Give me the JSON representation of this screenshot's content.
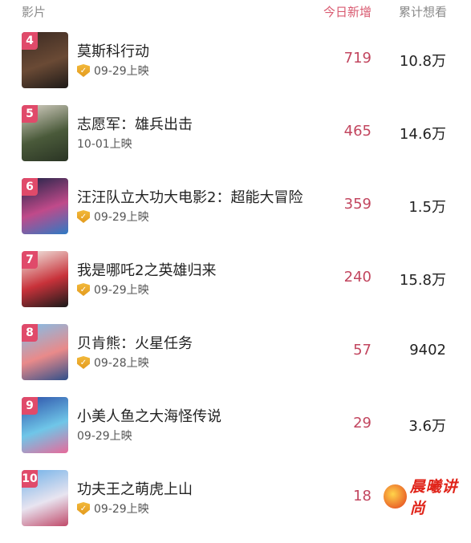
{
  "header": {
    "movie_label": "影片",
    "today_label": "今日新增",
    "total_label": "累计想看"
  },
  "movies": [
    {
      "rank": "4",
      "title": "莫斯科行动",
      "date": "09-29上映",
      "badge": true,
      "today": "719",
      "total": "10.8万",
      "poster_colors": [
        "#3b2a22",
        "#6a4a35",
        "#1e1a18"
      ]
    },
    {
      "rank": "5",
      "title": "志愿军：雄兵出击",
      "date": "10-01上映",
      "badge": false,
      "today": "465",
      "total": "14.6万",
      "poster_colors": [
        "#d8d2c6",
        "#4a5a3a",
        "#2a3424"
      ]
    },
    {
      "rank": "6",
      "title": "汪汪队立大功大电影2：超能大冒险",
      "date": "09-29上映",
      "badge": true,
      "today": "359",
      "total": "1.5万",
      "poster_colors": [
        "#1d2346",
        "#c04a8a",
        "#2e7ac4"
      ]
    },
    {
      "rank": "7",
      "title": "我是哪吒2之英雄归来",
      "date": "09-29上映",
      "badge": true,
      "today": "240",
      "total": "15.8万",
      "poster_colors": [
        "#f2efe8",
        "#c8323a",
        "#1a1a1a"
      ]
    },
    {
      "rank": "8",
      "title": "贝肯熊：火星任务",
      "date": "09-28上映",
      "badge": true,
      "today": "57",
      "total": "9402",
      "poster_colors": [
        "#7fc0ec",
        "#e98a8a",
        "#2f4f8a"
      ]
    },
    {
      "rank": "9",
      "title": "小美人鱼之大海怪传说",
      "date": "09-29上映",
      "badge": false,
      "today": "29",
      "total": "3.6万",
      "poster_colors": [
        "#2c4fa8",
        "#6fc6e8",
        "#e86a9a"
      ]
    },
    {
      "rank": "10",
      "title": "功夫王之萌虎上山",
      "date": "09-29上映",
      "badge": true,
      "today": "18",
      "total": "",
      "poster_colors": [
        "#6fb0e8",
        "#e8e4f0",
        "#c04a6a"
      ]
    }
  ],
  "watermark": {
    "text": "晨曦讲尚"
  }
}
